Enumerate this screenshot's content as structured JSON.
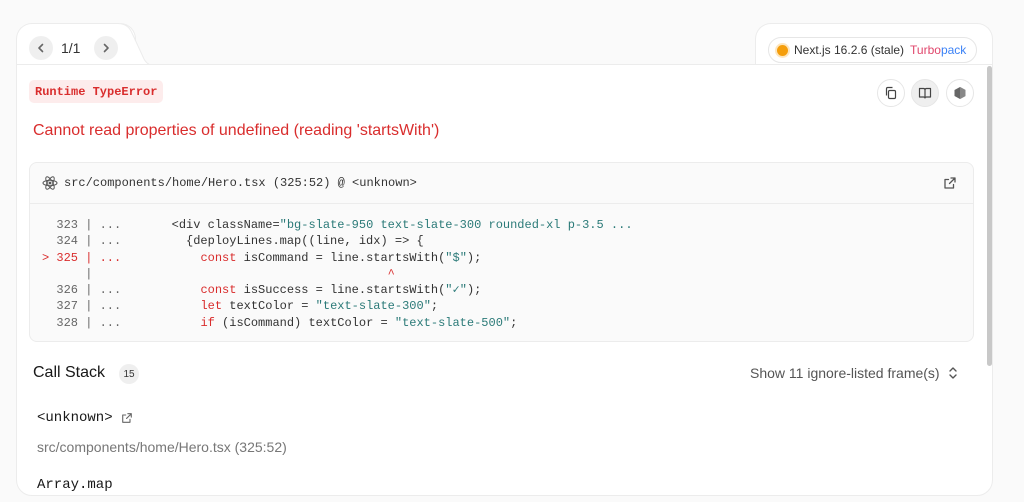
{
  "nav": {
    "count": "1/1"
  },
  "version": {
    "label": "Next.js 16.2.6 (stale)",
    "turbo_prefix": "Turbo",
    "turbo_suffix": "pack"
  },
  "error": {
    "type_label": "Runtime TypeError",
    "message": "Cannot read properties of undefined (reading 'startsWith')"
  },
  "toolbar": {
    "icons": [
      "copy-icon",
      "docs-icon",
      "nextjs-icon"
    ]
  },
  "code_frame": {
    "file": "src/components/home/Hero.tsx (325:52) @ <unknown>",
    "lines": [
      {
        "gutter": "  323 | ...",
        "parts": [
          {
            "t": "       <div className=",
            "c": ""
          },
          {
            "t": "\"bg-slate-950 text-slate-300 rounded-xl p-3.5 ...",
            "c": "str"
          }
        ]
      },
      {
        "gutter": "  324 | ...",
        "parts": [
          {
            "t": "         {deployLines.map((line, idx) => {",
            "c": ""
          }
        ]
      },
      {
        "gutter": "> 325 | ...",
        "hl": true,
        "parts": [
          {
            "t": "           ",
            "c": ""
          },
          {
            "t": "const",
            "c": "kw"
          },
          {
            "t": " isCommand = line.startsWith(",
            "c": ""
          },
          {
            "t": "\"$\"",
            "c": "str"
          },
          {
            "t": ");",
            "c": ""
          }
        ]
      },
      {
        "gutter": "      |    ",
        "parts": [
          {
            "t": "                                     ",
            "c": ""
          },
          {
            "t": "^",
            "c": "caret"
          }
        ]
      },
      {
        "gutter": "  326 | ...",
        "parts": [
          {
            "t": "           ",
            "c": ""
          },
          {
            "t": "const",
            "c": "kw"
          },
          {
            "t": " isSuccess = line.startsWith(",
            "c": ""
          },
          {
            "t": "\"✓\"",
            "c": "str"
          },
          {
            "t": ");",
            "c": ""
          }
        ]
      },
      {
        "gutter": "  327 | ...",
        "parts": [
          {
            "t": "           ",
            "c": ""
          },
          {
            "t": "let",
            "c": "kw"
          },
          {
            "t": " textColor = ",
            "c": ""
          },
          {
            "t": "\"text-slate-300\"",
            "c": "str"
          },
          {
            "t": ";",
            "c": ""
          }
        ]
      },
      {
        "gutter": "  328 | ...",
        "parts": [
          {
            "t": "           ",
            "c": ""
          },
          {
            "t": "if",
            "c": "kw"
          },
          {
            "t": " (isCommand) textColor = ",
            "c": ""
          },
          {
            "t": "\"text-slate-500\"",
            "c": "str"
          },
          {
            "t": ";",
            "c": ""
          }
        ]
      }
    ]
  },
  "call_stack": {
    "title": "Call Stack",
    "count": "15",
    "ignore_toggle": "Show 11 ignore-listed frame(s)",
    "frames": [
      {
        "name": "<unknown>",
        "location": "src/components/home/Hero.tsx (325:52)"
      },
      {
        "name": "Array.map"
      }
    ]
  },
  "colors": {
    "error": "#d92d2d",
    "stale_dot": "#f59e0b",
    "turbo": "#e0456b",
    "pack": "#3b82f6"
  }
}
